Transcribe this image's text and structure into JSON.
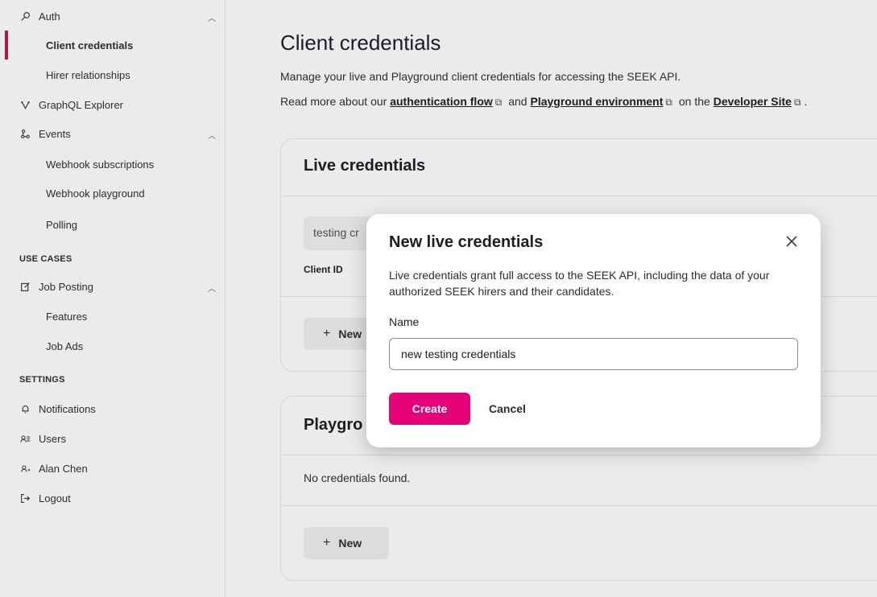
{
  "sidebar": {
    "auth": {
      "label": "Auth",
      "icon": "key-icon"
    },
    "client_credentials": "Client credentials",
    "hirer_relationships": "Hirer relationships",
    "graphql_explorer": {
      "label": "GraphQL Explorer",
      "icon": "graphql-icon"
    },
    "events": {
      "label": "Events",
      "icon": "events-icon"
    },
    "webhook_subscriptions": "Webhook subscriptions",
    "webhook_playground": "Webhook playground",
    "polling": "Polling",
    "use_cases_label": "USE CASES",
    "job_posting": {
      "label": "Job Posting",
      "icon": "edit-icon"
    },
    "features": "Features",
    "job_ads": "Job Ads",
    "settings_label": "SETTINGS",
    "notifications": {
      "label": "Notifications",
      "icon": "bell-icon"
    },
    "users": {
      "label": "Users",
      "icon": "users-icon"
    },
    "profile": {
      "label": "Alan Chen",
      "icon": "user-icon"
    },
    "logout": {
      "label": "Logout",
      "icon": "logout-icon"
    }
  },
  "main": {
    "title": "Client credentials",
    "description": "Manage your live and Playground client credentials for accessing the SEEK API.",
    "links": {
      "prefix": "Read more about our",
      "auth_flow": "authentication flow",
      "and": "and",
      "playground_env": "Playground environment",
      "on_the": "on the",
      "developer_site": "Developer Site",
      "suffix": "."
    },
    "live_card": {
      "title": "Live credentials",
      "credential_name": "testing cr",
      "client_id_label": "Client ID",
      "new_button": "New"
    },
    "playground_card": {
      "title": "Playgro",
      "empty": "No credentials found.",
      "new_button": "New"
    }
  },
  "modal": {
    "title": "New live credentials",
    "description": "Live credentials grant full access to the SEEK API, including the data of your authorized SEEK hirers and their candidates.",
    "name_label": "Name",
    "name_value": "new testing credentials",
    "create_button": "Create",
    "cancel_button": "Cancel"
  },
  "colors": {
    "accent": "#e60278",
    "active_indicator": "#b2184c"
  }
}
